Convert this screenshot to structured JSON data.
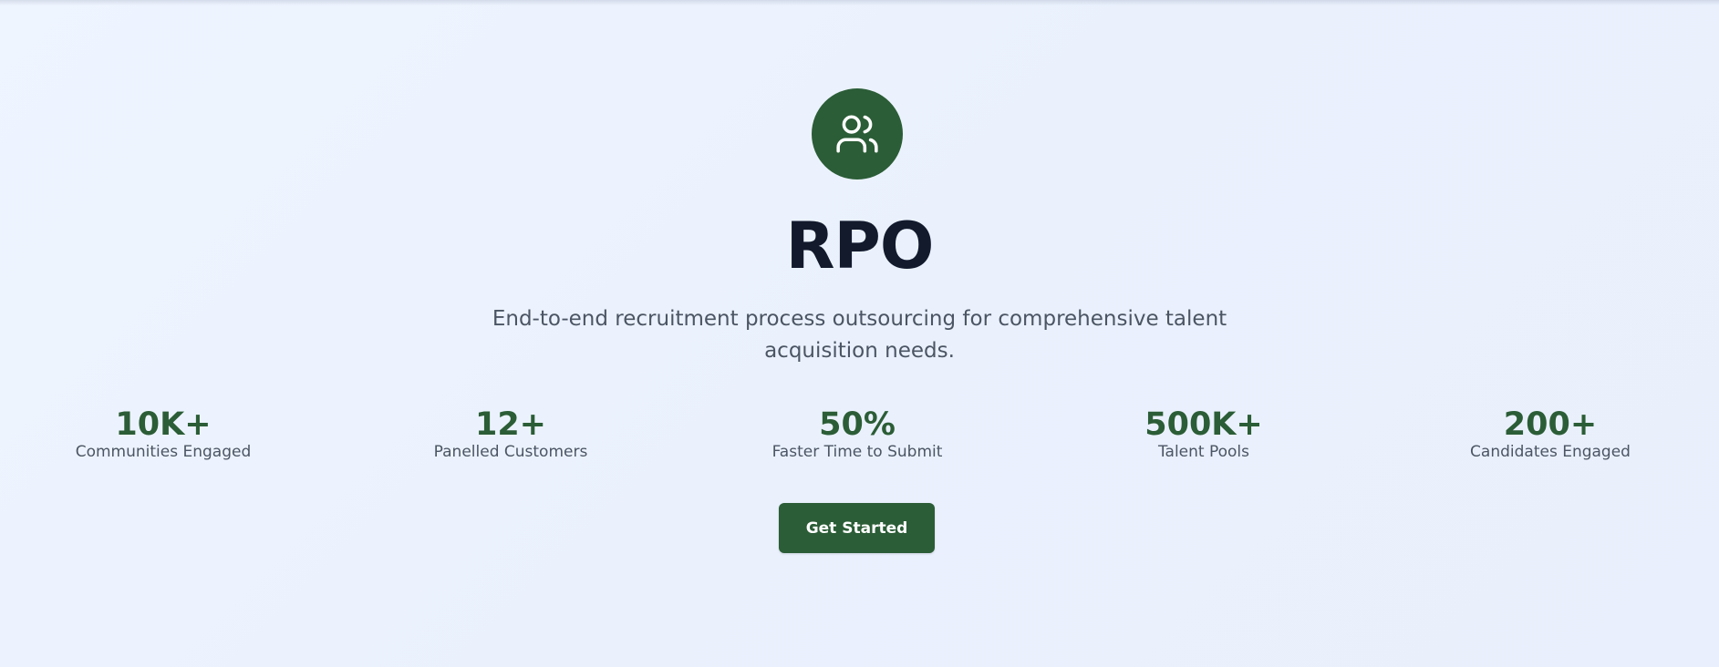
{
  "hero": {
    "icon": "users-icon",
    "title": "RPO",
    "subtitle": "End-to-end recruitment process outsourcing for comprehensive talent acquisition needs."
  },
  "stats": [
    {
      "value": "10K+",
      "label": "Communities Engaged"
    },
    {
      "value": "12+",
      "label": "Panelled Customers"
    },
    {
      "value": "50%",
      "label": "Faster Time to Submit"
    },
    {
      "value": "500K+",
      "label": "Talent Pools"
    },
    {
      "value": "200+",
      "label": "Candidates Engaged"
    }
  ],
  "cta": {
    "label": "Get Started"
  },
  "colors": {
    "brand": "#2b5d36",
    "title": "#121a2c",
    "muted": "#4b5563",
    "background": "#eef3fe"
  }
}
